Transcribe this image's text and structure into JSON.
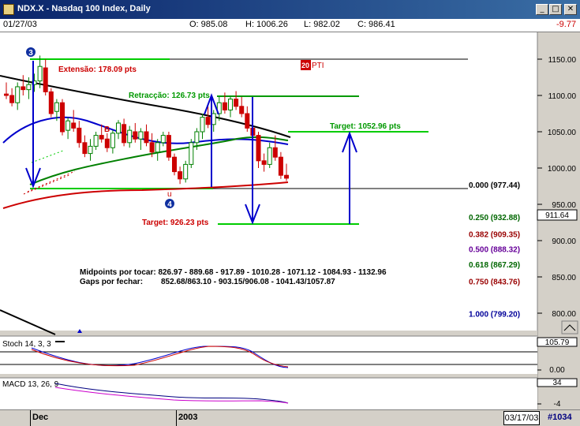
{
  "window": {
    "title": "NDX.X - Nasdaq 100 Index, Daily",
    "minimize": "_",
    "maximize": "□",
    "close": "✕"
  },
  "info": {
    "date": "01/27/03",
    "open": "O: 985.08",
    "high": "H: 1006.26",
    "low": "L: 982.02",
    "close": "C: 986.41",
    "change": "-9.77"
  },
  "colors": {
    "up": "#008000",
    "down": "#cc0000",
    "blue": "#0000cc",
    "green_line": "#00cc00",
    "dark_green": "#006600"
  },
  "chart_data": {
    "type": "candlestick",
    "ylim": [
      760,
      1190
    ],
    "yticks": [
      "1150.00",
      "1100.00",
      "1050.00",
      "1000.00",
      "950.00",
      "900.00",
      "850.00",
      "800.00"
    ],
    "last_price_label": "911.64",
    "candles": [
      [
        1102,
        1118,
        1095,
        1100
      ],
      [
        1100,
        1110,
        1085,
        1090
      ],
      [
        1090,
        1118,
        1080,
        1112
      ],
      [
        1112,
        1128,
        1100,
        1108
      ],
      [
        1108,
        1125,
        1095,
        1115
      ],
      [
        1115,
        1130,
        1105,
        1120
      ],
      [
        1120,
        1155,
        1110,
        1140
      ],
      [
        1138,
        1150,
        1100,
        1105
      ],
      [
        1105,
        1110,
        1070,
        1075
      ],
      [
        1078,
        1095,
        1065,
        1090
      ],
      [
        1090,
        1095,
        1045,
        1050
      ],
      [
        1052,
        1070,
        1040,
        1065
      ],
      [
        1062,
        1080,
        1050,
        1055
      ],
      [
        1055,
        1065,
        1028,
        1035
      ],
      [
        1035,
        1045,
        1015,
        1020
      ],
      [
        1020,
        1040,
        1010,
        1030
      ],
      [
        1030,
        1050,
        1025,
        1045
      ],
      [
        1045,
        1060,
        1035,
        1040
      ],
      [
        1040,
        1048,
        1022,
        1028
      ],
      [
        1028,
        1052,
        1020,
        1048
      ],
      [
        1048,
        1066,
        1040,
        1062
      ],
      [
        1060,
        1068,
        1030,
        1035
      ],
      [
        1035,
        1058,
        1028,
        1052
      ],
      [
        1050,
        1062,
        1035,
        1040
      ],
      [
        1040,
        1055,
        1025,
        1050
      ],
      [
        1050,
        1060,
        1030,
        1035
      ],
      [
        1035,
        1048,
        1015,
        1022
      ],
      [
        1022,
        1040,
        1010,
        1035
      ],
      [
        1035,
        1050,
        1030,
        1045
      ],
      [
        1045,
        1050,
        1010,
        1015
      ],
      [
        1015,
        1020,
        990,
        995
      ],
      [
        995,
        1002,
        978,
        985
      ],
      [
        985,
        1010,
        980,
        1005
      ],
      [
        1005,
        1040,
        1000,
        1035
      ],
      [
        1035,
        1055,
        1025,
        1050
      ],
      [
        1050,
        1075,
        1040,
        1070
      ],
      [
        1070,
        1085,
        1055,
        1060
      ],
      [
        1060,
        1080,
        1050,
        1075
      ],
      [
        1075,
        1098,
        1065,
        1090
      ],
      [
        1090,
        1104,
        1075,
        1080
      ],
      [
        1080,
        1100,
        1070,
        1095
      ],
      [
        1095,
        1106,
        1080,
        1085
      ],
      [
        1085,
        1098,
        1070,
        1075
      ],
      [
        1075,
        1085,
        1050,
        1055
      ],
      [
        1055,
        1065,
        1040,
        1045
      ],
      [
        1045,
        1050,
        1000,
        1010
      ],
      [
        1010,
        1020,
        995,
        1005
      ],
      [
        1005,
        1035,
        1000,
        1028
      ],
      [
        1028,
        1045,
        1010,
        1015
      ],
      [
        1015,
        1022,
        985,
        990
      ],
      [
        990,
        1006,
        982,
        986
      ]
    ],
    "fib_levels": [
      {
        "label": "0.000 (977.44)",
        "color": "#000000"
      },
      {
        "label": "0.250 (932.88)",
        "color": "#006600"
      },
      {
        "label": "0.382 (909.35)",
        "color": "#990000"
      },
      {
        "label": "0.500 (888.32)",
        "color": "#660099"
      },
      {
        "label": "0.618 (867.29)",
        "color": "#006600"
      },
      {
        "label": "0.750 (843.76)",
        "color": "#990000"
      },
      {
        "label": "1.000 (799.20)",
        "color": "#000099"
      }
    ],
    "annotations": {
      "extension": "Extensão: 178.09 pts",
      "retracement": "Retracção: 126.73 pts",
      "target_up": "Target: 1052.96 pts",
      "target_down": "Target: 926.23 pts",
      "pti": "PTI",
      "pti_num": "20",
      "marker3": "3",
      "marker4": "4",
      "markerB": "B",
      "markerU": "u",
      "midpoints": "Midpoints por tocar: 826.97 - 889.68 - 917.89 - 1010.28 - 1071.12 - 1084.93 - 1132.96",
      "gaps_label": "Gaps por fechar:",
      "gaps_values": "852.68/863.10 - 903.15/906.08 - 1041.43/1057.87"
    },
    "stoch_label": "Stoch 14, 3, 3",
    "stoch_ticks": [
      "105.79",
      "0.00"
    ],
    "macd_label": "MACD 13, 26, 9",
    "macd_ticks": [
      "34",
      "-4"
    ]
  },
  "bottom": {
    "dec": "Dec",
    "year": "2003",
    "date": "03/17/03",
    "id": "#1034"
  }
}
